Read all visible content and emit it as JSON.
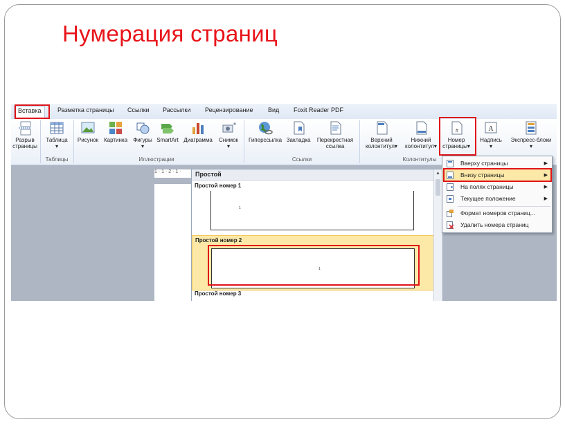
{
  "slide": {
    "title": "Нумерация страниц"
  },
  "tabs": [
    "Вставка",
    "Разметка страницы",
    "Ссылки",
    "Рассылки",
    "Рецензирование",
    "Вид",
    "Foxit Reader PDF"
  ],
  "ribbon": {
    "page_break": [
      "Разрыв",
      "страницы"
    ],
    "table": "Таблица",
    "picture": "Рисунок",
    "clipart": "Картинка",
    "shapes": "Фигуры",
    "smartart": "SmartArt",
    "chart": "Диаграмма",
    "screenshot": "Снимок",
    "hyperlink": "Гиперссылка",
    "bookmark": "Закладка",
    "crossref": [
      "Перекрестная",
      "ссылка"
    ],
    "header": [
      "Верхний",
      "колонтитул"
    ],
    "footer": [
      "Нижний",
      "колонтитул"
    ],
    "page_number": [
      "Номер",
      "страницы"
    ],
    "textbox": "Надпись",
    "quickparts": "Экспресс-блоки",
    "groups": {
      "tables": "Таблицы",
      "illustrations": "Иллюстрации",
      "links": "Ссылки",
      "headers": "Колонтитулы"
    }
  },
  "ruler_text": "1 · 1 · 2 · 1 ·",
  "gallery": {
    "header": "Простой",
    "items": [
      "Простой номер 1",
      "Простой номер 2",
      "Простой номер 3"
    ],
    "page_num": "1"
  },
  "menu": {
    "items": [
      "Вверху страницы",
      "Внизу страницы",
      "На полях страницы",
      "Текущее положение",
      "Формат номеров страниц...",
      "Удалить номера страниц"
    ]
  },
  "colors": {
    "title": "#e8141a",
    "highlight": "#fce9a8",
    "annotation": "#e0141a"
  }
}
